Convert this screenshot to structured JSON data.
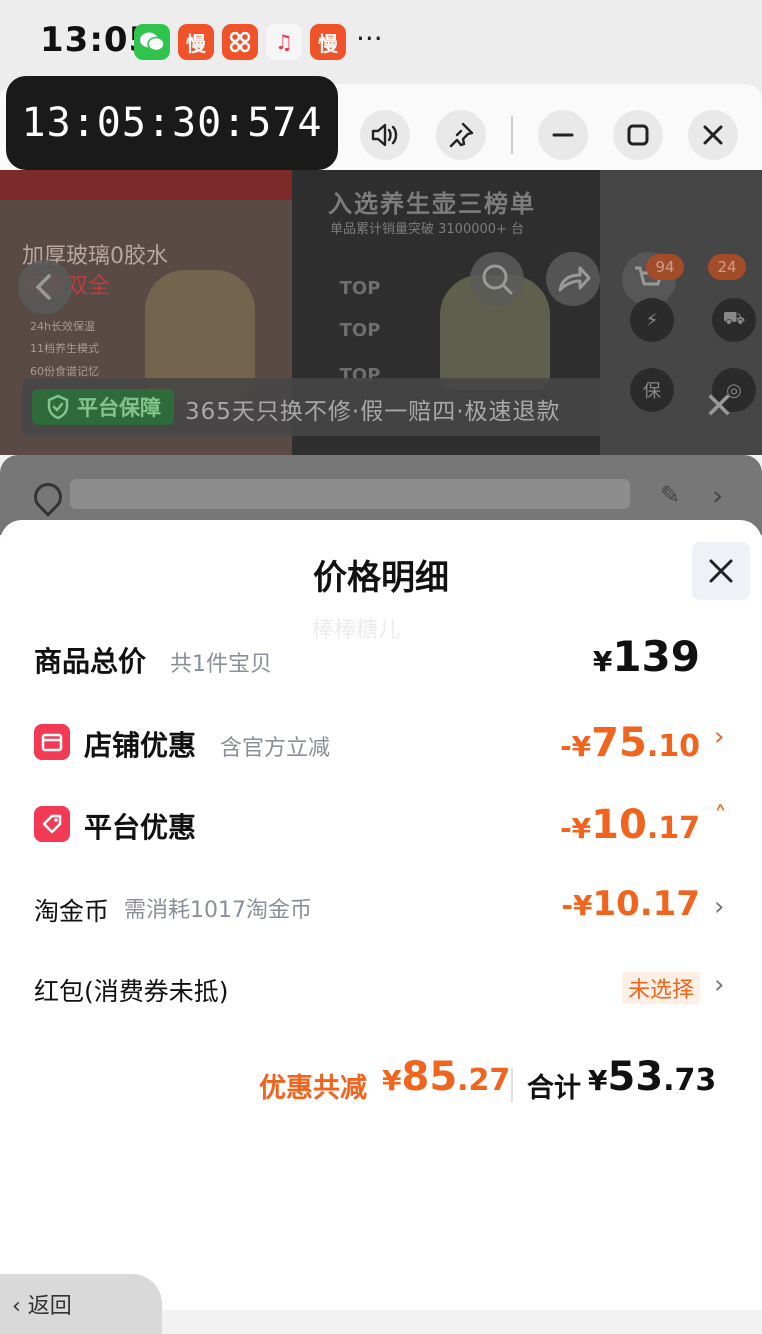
{
  "status_bar": {
    "time": "13:05",
    "apps": [
      {
        "name": "wechat-icon",
        "glyph": "●",
        "color": "#2ec44e"
      },
      {
        "name": "slow-icon",
        "glyph": "慢",
        "color": "#f0522a"
      },
      {
        "name": "apps-grid-icon",
        "glyph": "⌘",
        "color": "#f0522a"
      },
      {
        "name": "music-icon",
        "glyph": "♫",
        "color": "#f3f3f3"
      },
      {
        "name": "slow-icon-2",
        "glyph": "慢",
        "color": "#f0522a"
      }
    ],
    "more": "···"
  },
  "floating_clock": "13:05:30:574",
  "product_preview": {
    "left_line1": "加厚玻璃0胶水",
    "left_line2": "炖煮双全",
    "left_sub": [
      "24h长效保温",
      "11档养生模式",
      "60份食谱记忆"
    ],
    "headline": "入选养生壶三榜单",
    "sales": "单品累计销量突破 3100000+ 台",
    "top_badges": [
      "TOP",
      "TOP",
      "TOP"
    ],
    "cart_badges": [
      "94",
      "24"
    ],
    "guarantee_badge": "平台保障",
    "guarantee_text": "365天只换不修·假一赔四·极速退款"
  },
  "price_sheet": {
    "title": "价格明细",
    "watermark": "棒棒糖儿",
    "rows": {
      "total": {
        "label": "商品总价",
        "note": "共1件宝贝",
        "yen": "¥",
        "int": "139",
        "dec": ""
      },
      "shop": {
        "label": "店铺优惠",
        "note": "含官方立减",
        "yen": "-¥",
        "int": "75",
        "dec": ".10"
      },
      "platform": {
        "label": "平台优惠",
        "yen": "-¥",
        "int": "10",
        "dec": ".17"
      },
      "coins": {
        "label": "淘金币",
        "note": "需消耗1017淘金币",
        "yen": "-¥",
        "int": "10",
        "dec": ".17"
      },
      "redpack": {
        "label": "红包(消费券未抵)",
        "chip": "未选择"
      }
    },
    "summary": {
      "discount_label": "优惠共减",
      "discount_yen": "¥",
      "discount_int": "85",
      "discount_dec": ".27",
      "total_label": "合计",
      "total_yen": "¥",
      "total_int": "53",
      "total_dec": ".73"
    }
  },
  "back_label": "返回",
  "colors": {
    "accent": "#f0641e",
    "shop_icon": "#f23a55"
  }
}
